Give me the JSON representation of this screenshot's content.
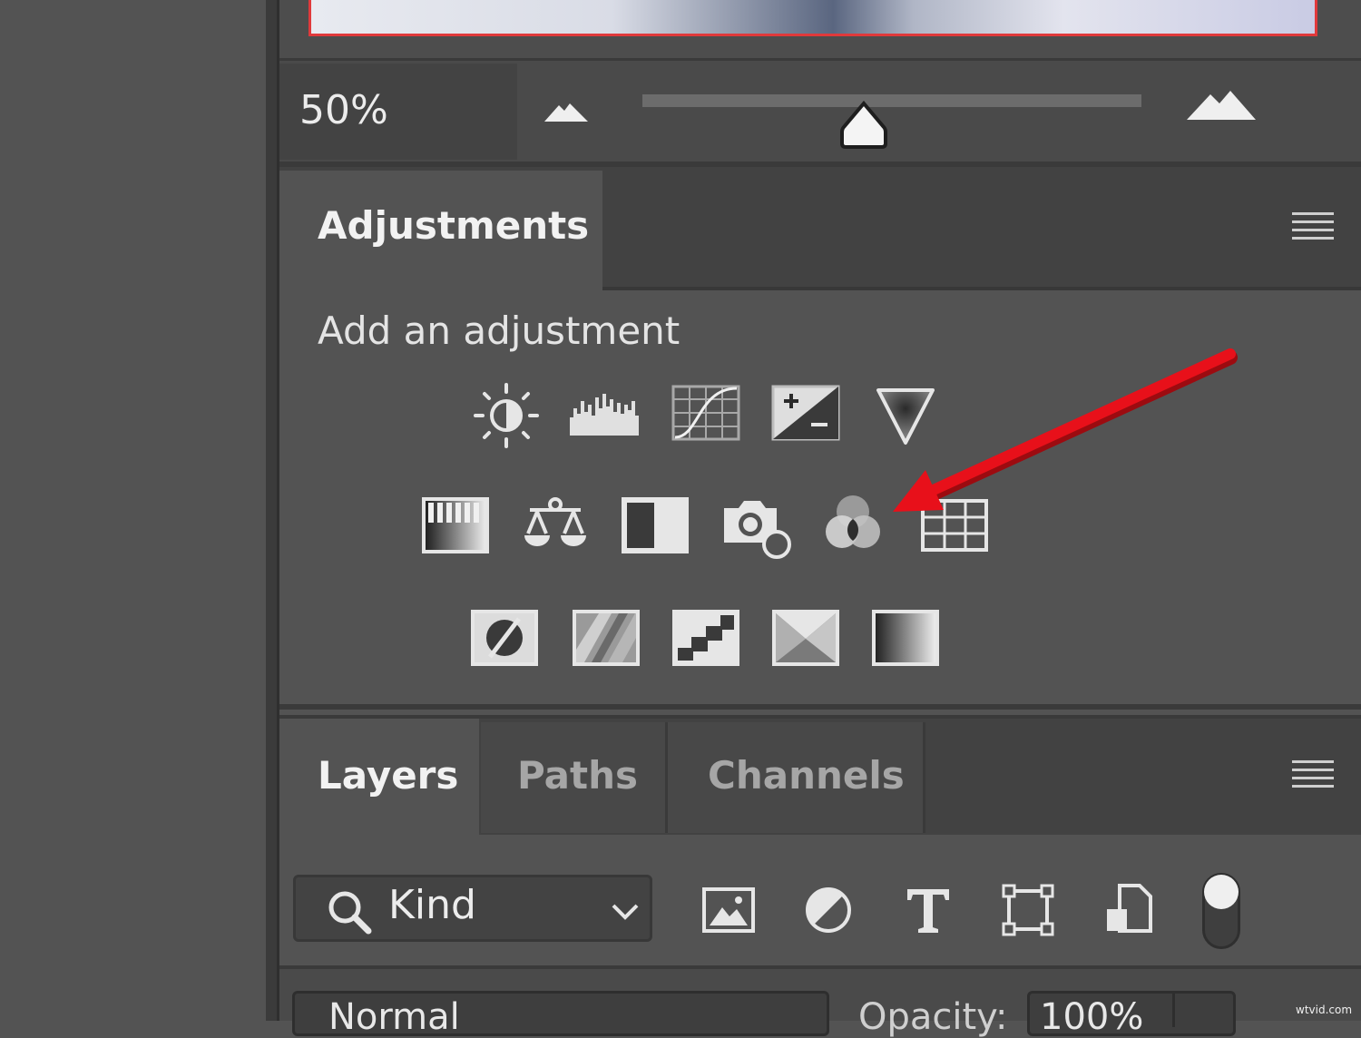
{
  "navigator": {
    "zoom_value": "50%",
    "zoom_slider_fraction": 0.44
  },
  "adjustments": {
    "tab_label": "Adjustments",
    "subtitle": "Add an adjustment",
    "row1": [
      "brightness-contrast-icon",
      "levels-icon",
      "curves-icon",
      "exposure-icon",
      "vibrance-icon"
    ],
    "row2": [
      "hue-saturation-icon",
      "color-balance-icon",
      "black-white-icon",
      "photo-filter-icon",
      "channel-mixer-icon",
      "color-lookup-icon"
    ],
    "row3": [
      "invert-icon",
      "posterize-icon",
      "threshold-icon",
      "selective-color-icon",
      "gradient-map-icon"
    ],
    "highlighted": "channel-mixer-icon",
    "arrow_color": "#e8101a"
  },
  "layers": {
    "tabs": [
      "Layers",
      "Paths",
      "Channels"
    ],
    "active_tab": "Layers",
    "filter_kind": "Kind",
    "blend_mode": "Normal",
    "opacity_label": "Opacity:",
    "opacity_value": "100%"
  },
  "watermark": "wtvid.com"
}
